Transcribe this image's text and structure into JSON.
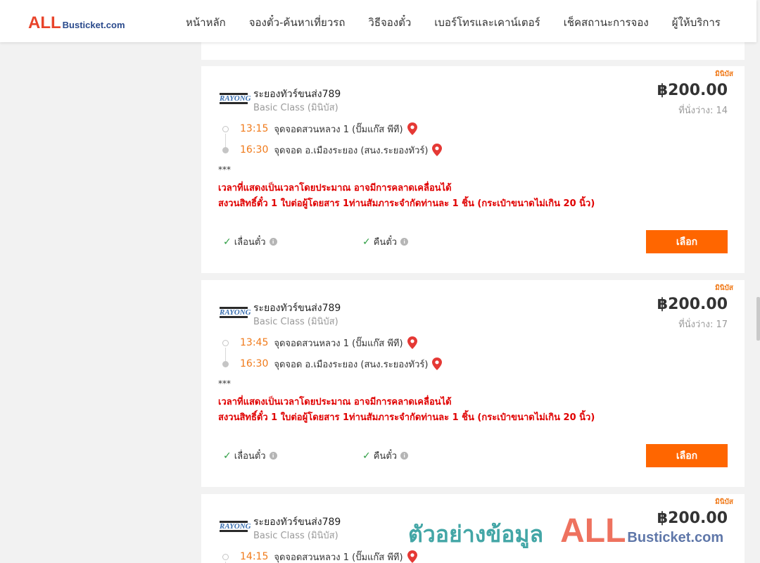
{
  "header": {
    "logo_all": "ALL",
    "logo_suffix": "Busticket.com",
    "nav": [
      "หน้าหลัก",
      "จองตั๋ว-ค้นหาเที่ยวรถ",
      "วิธีจองตั๋ว",
      "เบอร์โทรและเคาน์เตอร์",
      "เช็คสถานะการจอง",
      "ผู้ให้บริการ"
    ]
  },
  "trips": [
    {
      "tag": "มินิบัส",
      "operator": "ระยองทัวร์ขนส่ง789",
      "operator_logo": "RAYONG",
      "class": "Basic Class (มินิบัส)",
      "price": "฿200.00",
      "seats": "ที่นั่งว่าง: 14",
      "depart_time": "13:15",
      "depart_place": "จุดจอดสวนหลวง 1 (ปั๊มแก๊ส พีที)",
      "arrive_time": "16:30",
      "arrive_place": "จุดจอด อ.เมืองระยอง (สนง.ระยองทัวร์)",
      "stars": "***",
      "notice1": "เวลาที่แสดงเป็นเวลาโดยประมาณ อาจมีการคลาดเคลื่อนได้",
      "notice2": "สงวนสิทธิ์ตั๋ว 1 ใบต่อผู้โดยสาร 1ท่านสัมภาระจำกัดท่านละ 1 ชิ้น (กระเป๋าขนาดไม่เกิน 20 นิ้ว)",
      "policy_change": "เลื่อนตั๋ว",
      "policy_refund": "คืนตั๋ว",
      "button": "เลือก"
    },
    {
      "tag": "มินิบัส",
      "operator": "ระยองทัวร์ขนส่ง789",
      "operator_logo": "RAYONG",
      "class": "Basic Class (มินิบัส)",
      "price": "฿200.00",
      "seats": "ที่นั่งว่าง: 17",
      "depart_time": "13:45",
      "depart_place": "จุดจอดสวนหลวง 1 (ปั๊มแก๊ส พีที)",
      "arrive_time": "16:30",
      "arrive_place": "จุดจอด อ.เมืองระยอง (สนง.ระยองทัวร์)",
      "stars": "***",
      "notice1": "เวลาที่แสดงเป็นเวลาโดยประมาณ อาจมีการคลาดเคลื่อนได้",
      "notice2": "สงวนสิทธิ์ตั๋ว 1 ใบต่อผู้โดยสาร 1ท่านสัมภาระจำกัดท่านละ 1 ชิ้น (กระเป๋าขนาดไม่เกิน 20 นิ้ว)",
      "policy_change": "เลื่อนตั๋ว",
      "policy_refund": "คืนตั๋ว",
      "button": "เลือก"
    },
    {
      "tag": "มินิบัส",
      "operator": "ระยองทัวร์ขนส่ง789",
      "operator_logo": "RAYONG",
      "class": "Basic Class (มินิบัส)",
      "price": "฿200.00",
      "depart_time": "14:15",
      "depart_place": "จุดจอดสวนหลวง 1 (ปั๊มแก๊ส พีที)"
    }
  ],
  "watermark": {
    "thai": "ตัวอย่างข้อมูล",
    "all": "ALL",
    "suffix": "Busticket.com"
  },
  "colors": {
    "accent": "#ff6600",
    "time": "#f07a1a",
    "notice": "#e00000",
    "check": "#2f9e44",
    "pin": "#e53935"
  },
  "icons": {
    "pin": "map-pin-icon",
    "check": "check-icon",
    "info": "info-icon"
  }
}
